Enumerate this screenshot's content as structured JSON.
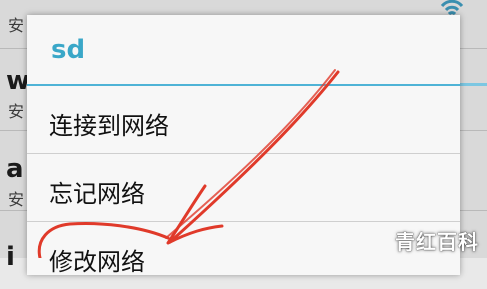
{
  "background": {
    "rows": [
      {
        "letter": "",
        "sub": "安"
      },
      {
        "letter": "w",
        "sub": "安"
      },
      {
        "letter": "a",
        "sub": "安"
      },
      {
        "letter": "i",
        "sub": ""
      }
    ]
  },
  "dialog": {
    "title": "sd",
    "items": [
      {
        "label": "连接到网络"
      },
      {
        "label": "忘记网络"
      },
      {
        "label": "修改网络"
      }
    ]
  },
  "watermark": "青红百科",
  "colors": {
    "accent": "#3aa7c8",
    "divider": "#4fb3d6",
    "annotation": "#e03a2a"
  },
  "icons": [
    "wifi-icon"
  ]
}
